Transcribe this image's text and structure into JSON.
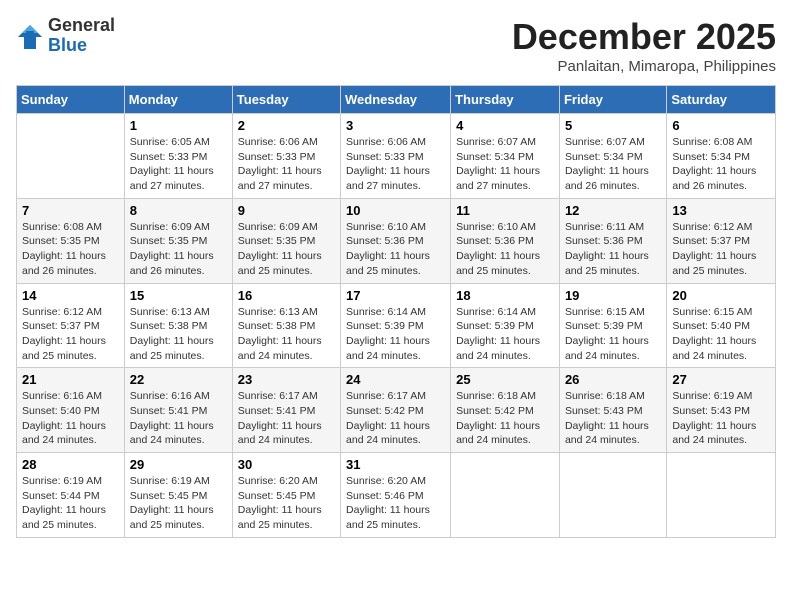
{
  "logo": {
    "general": "General",
    "blue": "Blue"
  },
  "header": {
    "month_year": "December 2025",
    "location": "Panlaitan, Mimaropa, Philippines"
  },
  "weekdays": [
    "Sunday",
    "Monday",
    "Tuesday",
    "Wednesday",
    "Thursday",
    "Friday",
    "Saturday"
  ],
  "weeks": [
    [
      {
        "day": "",
        "sunrise": "",
        "sunset": "",
        "daylight": ""
      },
      {
        "day": "1",
        "sunrise": "Sunrise: 6:05 AM",
        "sunset": "Sunset: 5:33 PM",
        "daylight": "Daylight: 11 hours and 27 minutes."
      },
      {
        "day": "2",
        "sunrise": "Sunrise: 6:06 AM",
        "sunset": "Sunset: 5:33 PM",
        "daylight": "Daylight: 11 hours and 27 minutes."
      },
      {
        "day": "3",
        "sunrise": "Sunrise: 6:06 AM",
        "sunset": "Sunset: 5:33 PM",
        "daylight": "Daylight: 11 hours and 27 minutes."
      },
      {
        "day": "4",
        "sunrise": "Sunrise: 6:07 AM",
        "sunset": "Sunset: 5:34 PM",
        "daylight": "Daylight: 11 hours and 27 minutes."
      },
      {
        "day": "5",
        "sunrise": "Sunrise: 6:07 AM",
        "sunset": "Sunset: 5:34 PM",
        "daylight": "Daylight: 11 hours and 26 minutes."
      },
      {
        "day": "6",
        "sunrise": "Sunrise: 6:08 AM",
        "sunset": "Sunset: 5:34 PM",
        "daylight": "Daylight: 11 hours and 26 minutes."
      }
    ],
    [
      {
        "day": "7",
        "sunrise": "Sunrise: 6:08 AM",
        "sunset": "Sunset: 5:35 PM",
        "daylight": "Daylight: 11 hours and 26 minutes."
      },
      {
        "day": "8",
        "sunrise": "Sunrise: 6:09 AM",
        "sunset": "Sunset: 5:35 PM",
        "daylight": "Daylight: 11 hours and 26 minutes."
      },
      {
        "day": "9",
        "sunrise": "Sunrise: 6:09 AM",
        "sunset": "Sunset: 5:35 PM",
        "daylight": "Daylight: 11 hours and 25 minutes."
      },
      {
        "day": "10",
        "sunrise": "Sunrise: 6:10 AM",
        "sunset": "Sunset: 5:36 PM",
        "daylight": "Daylight: 11 hours and 25 minutes."
      },
      {
        "day": "11",
        "sunrise": "Sunrise: 6:10 AM",
        "sunset": "Sunset: 5:36 PM",
        "daylight": "Daylight: 11 hours and 25 minutes."
      },
      {
        "day": "12",
        "sunrise": "Sunrise: 6:11 AM",
        "sunset": "Sunset: 5:36 PM",
        "daylight": "Daylight: 11 hours and 25 minutes."
      },
      {
        "day": "13",
        "sunrise": "Sunrise: 6:12 AM",
        "sunset": "Sunset: 5:37 PM",
        "daylight": "Daylight: 11 hours and 25 minutes."
      }
    ],
    [
      {
        "day": "14",
        "sunrise": "Sunrise: 6:12 AM",
        "sunset": "Sunset: 5:37 PM",
        "daylight": "Daylight: 11 hours and 25 minutes."
      },
      {
        "day": "15",
        "sunrise": "Sunrise: 6:13 AM",
        "sunset": "Sunset: 5:38 PM",
        "daylight": "Daylight: 11 hours and 25 minutes."
      },
      {
        "day": "16",
        "sunrise": "Sunrise: 6:13 AM",
        "sunset": "Sunset: 5:38 PM",
        "daylight": "Daylight: 11 hours and 24 minutes."
      },
      {
        "day": "17",
        "sunrise": "Sunrise: 6:14 AM",
        "sunset": "Sunset: 5:39 PM",
        "daylight": "Daylight: 11 hours and 24 minutes."
      },
      {
        "day": "18",
        "sunrise": "Sunrise: 6:14 AM",
        "sunset": "Sunset: 5:39 PM",
        "daylight": "Daylight: 11 hours and 24 minutes."
      },
      {
        "day": "19",
        "sunrise": "Sunrise: 6:15 AM",
        "sunset": "Sunset: 5:39 PM",
        "daylight": "Daylight: 11 hours and 24 minutes."
      },
      {
        "day": "20",
        "sunrise": "Sunrise: 6:15 AM",
        "sunset": "Sunset: 5:40 PM",
        "daylight": "Daylight: 11 hours and 24 minutes."
      }
    ],
    [
      {
        "day": "21",
        "sunrise": "Sunrise: 6:16 AM",
        "sunset": "Sunset: 5:40 PM",
        "daylight": "Daylight: 11 hours and 24 minutes."
      },
      {
        "day": "22",
        "sunrise": "Sunrise: 6:16 AM",
        "sunset": "Sunset: 5:41 PM",
        "daylight": "Daylight: 11 hours and 24 minutes."
      },
      {
        "day": "23",
        "sunrise": "Sunrise: 6:17 AM",
        "sunset": "Sunset: 5:41 PM",
        "daylight": "Daylight: 11 hours and 24 minutes."
      },
      {
        "day": "24",
        "sunrise": "Sunrise: 6:17 AM",
        "sunset": "Sunset: 5:42 PM",
        "daylight": "Daylight: 11 hours and 24 minutes."
      },
      {
        "day": "25",
        "sunrise": "Sunrise: 6:18 AM",
        "sunset": "Sunset: 5:42 PM",
        "daylight": "Daylight: 11 hours and 24 minutes."
      },
      {
        "day": "26",
        "sunrise": "Sunrise: 6:18 AM",
        "sunset": "Sunset: 5:43 PM",
        "daylight": "Daylight: 11 hours and 24 minutes."
      },
      {
        "day": "27",
        "sunrise": "Sunrise: 6:19 AM",
        "sunset": "Sunset: 5:43 PM",
        "daylight": "Daylight: 11 hours and 24 minutes."
      }
    ],
    [
      {
        "day": "28",
        "sunrise": "Sunrise: 6:19 AM",
        "sunset": "Sunset: 5:44 PM",
        "daylight": "Daylight: 11 hours and 25 minutes."
      },
      {
        "day": "29",
        "sunrise": "Sunrise: 6:19 AM",
        "sunset": "Sunset: 5:45 PM",
        "daylight": "Daylight: 11 hours and 25 minutes."
      },
      {
        "day": "30",
        "sunrise": "Sunrise: 6:20 AM",
        "sunset": "Sunset: 5:45 PM",
        "daylight": "Daylight: 11 hours and 25 minutes."
      },
      {
        "day": "31",
        "sunrise": "Sunrise: 6:20 AM",
        "sunset": "Sunset: 5:46 PM",
        "daylight": "Daylight: 11 hours and 25 minutes."
      },
      {
        "day": "",
        "sunrise": "",
        "sunset": "",
        "daylight": ""
      },
      {
        "day": "",
        "sunrise": "",
        "sunset": "",
        "daylight": ""
      },
      {
        "day": "",
        "sunrise": "",
        "sunset": "",
        "daylight": ""
      }
    ]
  ]
}
